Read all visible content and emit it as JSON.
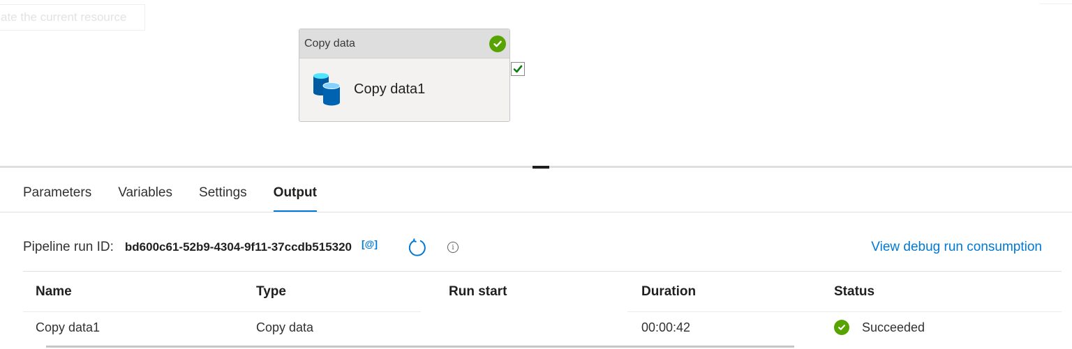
{
  "canvas": {
    "tooltip_text": "ate the current resource",
    "activity": {
      "type_label": "Copy data",
      "name": "Copy data1",
      "status_color": "#57a300",
      "icon": "database-icon"
    }
  },
  "tabs": [
    {
      "label": "Parameters",
      "active": false
    },
    {
      "label": "Variables",
      "active": false
    },
    {
      "label": "Settings",
      "active": false
    },
    {
      "label": "Output",
      "active": true
    }
  ],
  "output": {
    "run_id_label": "Pipeline run ID:",
    "run_id_value": "bd600c61-52b9-4304-9f11-37ccdb515320",
    "copy_icon_text": "[@]",
    "info_icon_text": "i",
    "debug_link": "View debug run consumption",
    "table": {
      "headers": [
        "Name",
        "Type",
        "Run start",
        "Duration",
        "Status"
      ],
      "rows": [
        {
          "name": "Copy data1",
          "type": "Copy data",
          "run_start": "",
          "duration": "00:00:42",
          "status": "Succeeded"
        }
      ]
    }
  },
  "colors": {
    "accent": "#0078d4",
    "success": "#57a300"
  }
}
